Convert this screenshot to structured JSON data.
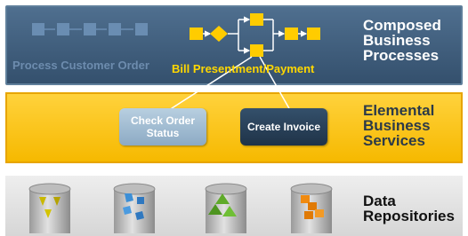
{
  "composed_layer": {
    "title": "Composed Business Processes",
    "processes": [
      {
        "label": "Process Customer Order"
      },
      {
        "label": "Bill Presentment/Payment"
      }
    ]
  },
  "elemental_layer": {
    "title": "Elemental Business Services",
    "services": [
      {
        "label": "Check Order Status"
      },
      {
        "label": "Create Invoice"
      }
    ]
  },
  "data_layer": {
    "title": "Data Repositories",
    "repositories": [
      {
        "icon": "database-yellow-pyramids-icon",
        "color": "#c9b800"
      },
      {
        "icon": "database-blue-cubes-icon",
        "color": "#3d8fd6"
      },
      {
        "icon": "database-green-pyramids-icon",
        "color": "#5faa2a"
      },
      {
        "icon": "database-orange-blocks-icon",
        "color": "#f08a10"
      }
    ]
  },
  "colors": {
    "composed_bg": "#3f5f7f",
    "elemental_bg": "#ffc61a",
    "data_bg": "#e0e0e0",
    "process_1": "#5f82a6",
    "process_2": "#ffcc00"
  }
}
